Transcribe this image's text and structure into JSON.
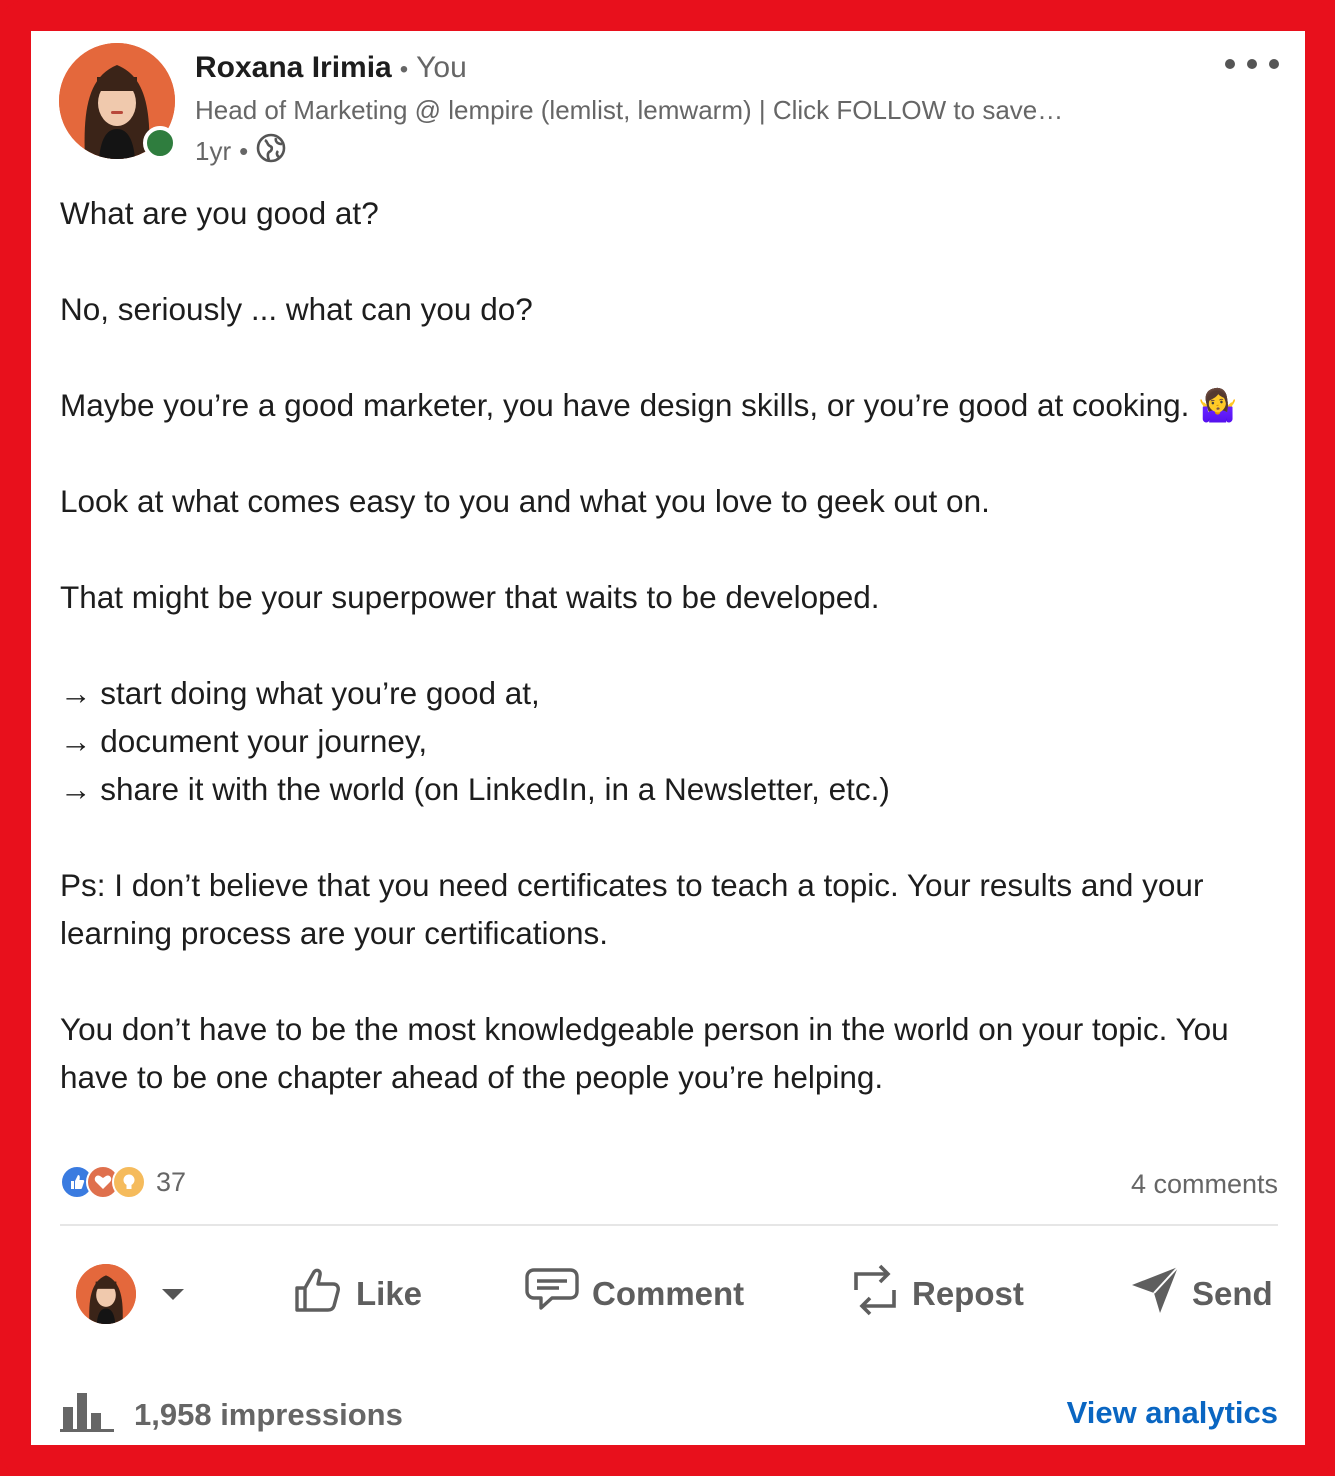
{
  "post": {
    "author_name": "Roxana Irimia",
    "author_separator": "•",
    "author_relation": "You",
    "headline": "Head of Marketing @ lempire (lemlist, lemwarm) | Click FOLLOW to save…",
    "time": "1yr",
    "time_separator": "•",
    "visibility_icon": "globe-icon",
    "paragraphs": [
      "What are you good at?",
      "No, seriously ... what can you do?",
      "Maybe you’re a good marketer, you have design skills, or you’re good at cooking. 🤷‍♀️",
      "Look at what comes easy to you and what you love to geek out on.",
      "That might be your superpower that waits to be developed."
    ],
    "bullets": [
      "→ start doing what you’re good at,",
      "→ document your journey,",
      "→ share it with the world (on LinkedIn, in a Newsletter, etc.)"
    ],
    "closing": [
      "Ps: I don’t believe that you need certificates to teach a topic. Your results and your learning process are your certifications.",
      "You don’t have to be the most knowledgeable person in the world on your topic. You have to be one chapter ahead of the people you’re helping."
    ]
  },
  "social": {
    "reaction_icons": [
      "like-reaction-icon",
      "love-reaction-icon",
      "insightful-reaction-icon"
    ],
    "reaction_count": "37",
    "comments": "4 comments"
  },
  "actions": {
    "like": "Like",
    "comment": "Comment",
    "repost": "Repost",
    "send": "Send"
  },
  "footer": {
    "impressions": "1,958 impressions",
    "view_analytics": "View analytics"
  },
  "colors": {
    "frame_red": "#e8101c",
    "link_blue": "#0a66c2",
    "online_green": "#2f7d3e",
    "avatar_orange": "#e4683c"
  }
}
